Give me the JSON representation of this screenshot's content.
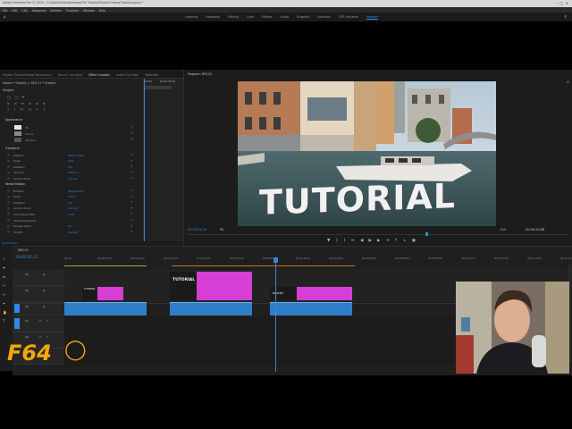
{
  "window": {
    "title": "Adobe Premiere Pro CC 2019 - C:\\Users\\Anton\\Desktop\\F64 Tutorial\\Tutorial Videos\\Tutorial.prproj *",
    "menu": [
      "File",
      "Edit",
      "Clip",
      "Sequence",
      "Markers",
      "Graphics",
      "Window",
      "Help"
    ]
  },
  "workspaces": {
    "items": [
      "Learning",
      "Assembly",
      "Editing",
      "Color",
      "Effects",
      "Audio",
      "Graphics",
      "Libraries",
      "CEP: Rename",
      "Rename"
    ],
    "active_index": 9
  },
  "left_panel": {
    "tabs": [
      "Project: TutorialVideos Rename.prj",
      "Source: (no clips)",
      "Effect Controls",
      "Audio Clip Mixer",
      "Metadata"
    ],
    "active_index": 2,
    "clip_path": "Master * Graphic  >  SEQ 01 * Graphic",
    "timecodes": [
      "00:00",
      "00:00:05:00"
    ],
    "section_appearance": "Appearance",
    "appearance_rows": [
      "Fill",
      "Stroke",
      "Shadow"
    ],
    "section_transform": "Transform",
    "transform_rows": [
      {
        "label": "Position",
        "value": "960.0   540.0"
      },
      {
        "label": "Scale",
        "value": "100"
      },
      {
        "label": "Rotation",
        "value": "0.0"
      },
      {
        "label": "Opacity",
        "value": "100.0 %"
      },
      {
        "label": "Anchor Point",
        "value": "0.0   0.0"
      }
    ],
    "section_vector": "Vector Motion",
    "vector_rows": [
      {
        "label": "Position",
        "value": "960.0   540.0"
      },
      {
        "label": "Scale",
        "value": "100.0"
      },
      {
        "label": "Rotation",
        "value": "0.0"
      },
      {
        "label": "Anchor Point",
        "value": "0.0   0.0"
      },
      {
        "label": "Anti-flicker Filter",
        "value": "0.00"
      }
    ],
    "extra_rows": [
      {
        "label": "Time Remapping",
        "value": ""
      },
      {
        "label": "Render Alpha",
        "value": "On"
      },
      {
        "label": "Stretch",
        "value": "Default"
      }
    ],
    "bottom_timecode": "00:00:01:01"
  },
  "program_monitor": {
    "tab": "Program: SEQ 01",
    "overlay_text": "TUTORIAL",
    "timecode_current": "00:00:01:05",
    "fit": "Fit",
    "quality": "Full",
    "timecode_duration": "00:00:20:08"
  },
  "timeline": {
    "tab": "SEQ 01",
    "timecode": "00:00:05:13",
    "ruler": [
      "00:00",
      "00:00:05:00",
      "00:00:10:00",
      "00:00:15:00",
      "00:00:20:00",
      "00:00:25:00",
      "00:00:30:00",
      "00:00:35:00",
      "00:00:40:00",
      "00:00:45:00",
      "00:00:50:00",
      "00:00:55:00",
      "00:01:00:00",
      "00:01:05:00",
      "00:01:10:00",
      "00:01:15:00"
    ],
    "video_tracks": [
      "V3",
      "V2",
      "V1"
    ],
    "audio_tracks": [
      "A1",
      "A2",
      "A3"
    ],
    "clips": [
      {
        "name": "TUTORIAL",
        "color": "#cf3fcf",
        "label": "TUTORIAL"
      },
      {
        "name": "Tutorial text",
        "color": "#cf3fcf",
        "label": "TUTORIAL"
      },
      {
        "name": "Tutorial text 2",
        "color": "#cf3fcf",
        "label": "tutorial"
      }
    ]
  },
  "logo": {
    "text": "F64"
  },
  "colors": {
    "accent_blue": "#2d8ceb",
    "clip_pink": "#d53fd5",
    "clip_blue": "#3a8fd8",
    "bg": "#1e1e1e"
  }
}
